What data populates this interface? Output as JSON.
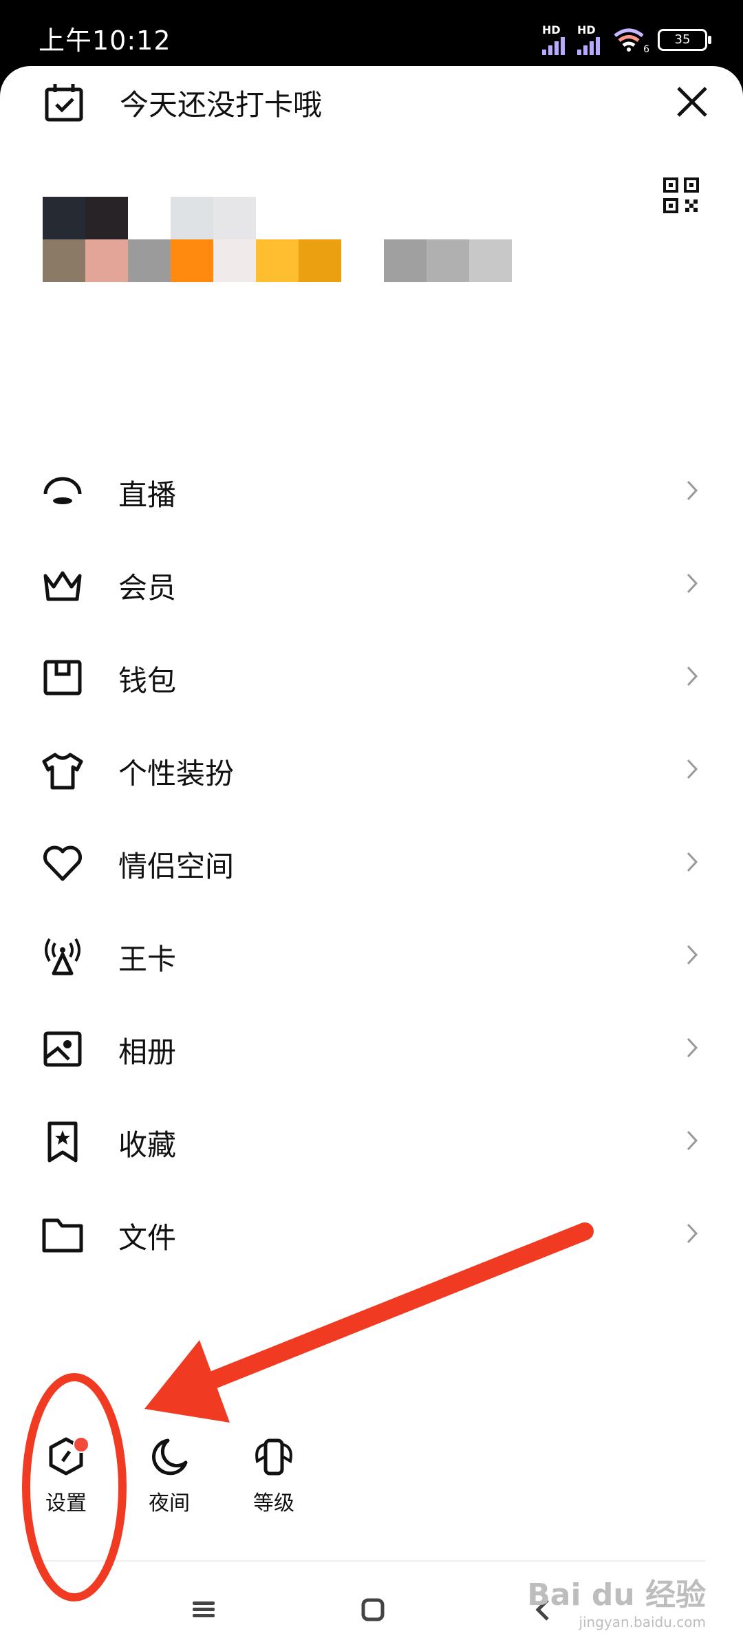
{
  "status_bar": {
    "time": "上午10:12",
    "signal1_label": "HD",
    "signal2_label": "HD",
    "wifi_label": "6",
    "battery": "35"
  },
  "header": {
    "checkin_text": "今天还没打卡哦"
  },
  "menu": {
    "items": [
      {
        "label": "直播",
        "icon": "live-icon"
      },
      {
        "label": "会员",
        "icon": "crown-icon"
      },
      {
        "label": "钱包",
        "icon": "wallet-icon"
      },
      {
        "label": "个性装扮",
        "icon": "tshirt-icon"
      },
      {
        "label": "情侣空间",
        "icon": "heart-icon"
      },
      {
        "label": "王卡",
        "icon": "antenna-icon"
      },
      {
        "label": "相册",
        "icon": "photo-icon"
      },
      {
        "label": "收藏",
        "icon": "bookmark-star-icon"
      },
      {
        "label": "文件",
        "icon": "folder-icon"
      }
    ]
  },
  "bottom_bar": {
    "settings_label": "设置",
    "night_label": "夜间",
    "level_label": "等级"
  },
  "watermark": {
    "brand": "Bai du 经验",
    "url": "jingyan.baidu.com"
  },
  "colors": {
    "annotation_red": "#f03b22",
    "badge_red": "#f24a3b"
  }
}
